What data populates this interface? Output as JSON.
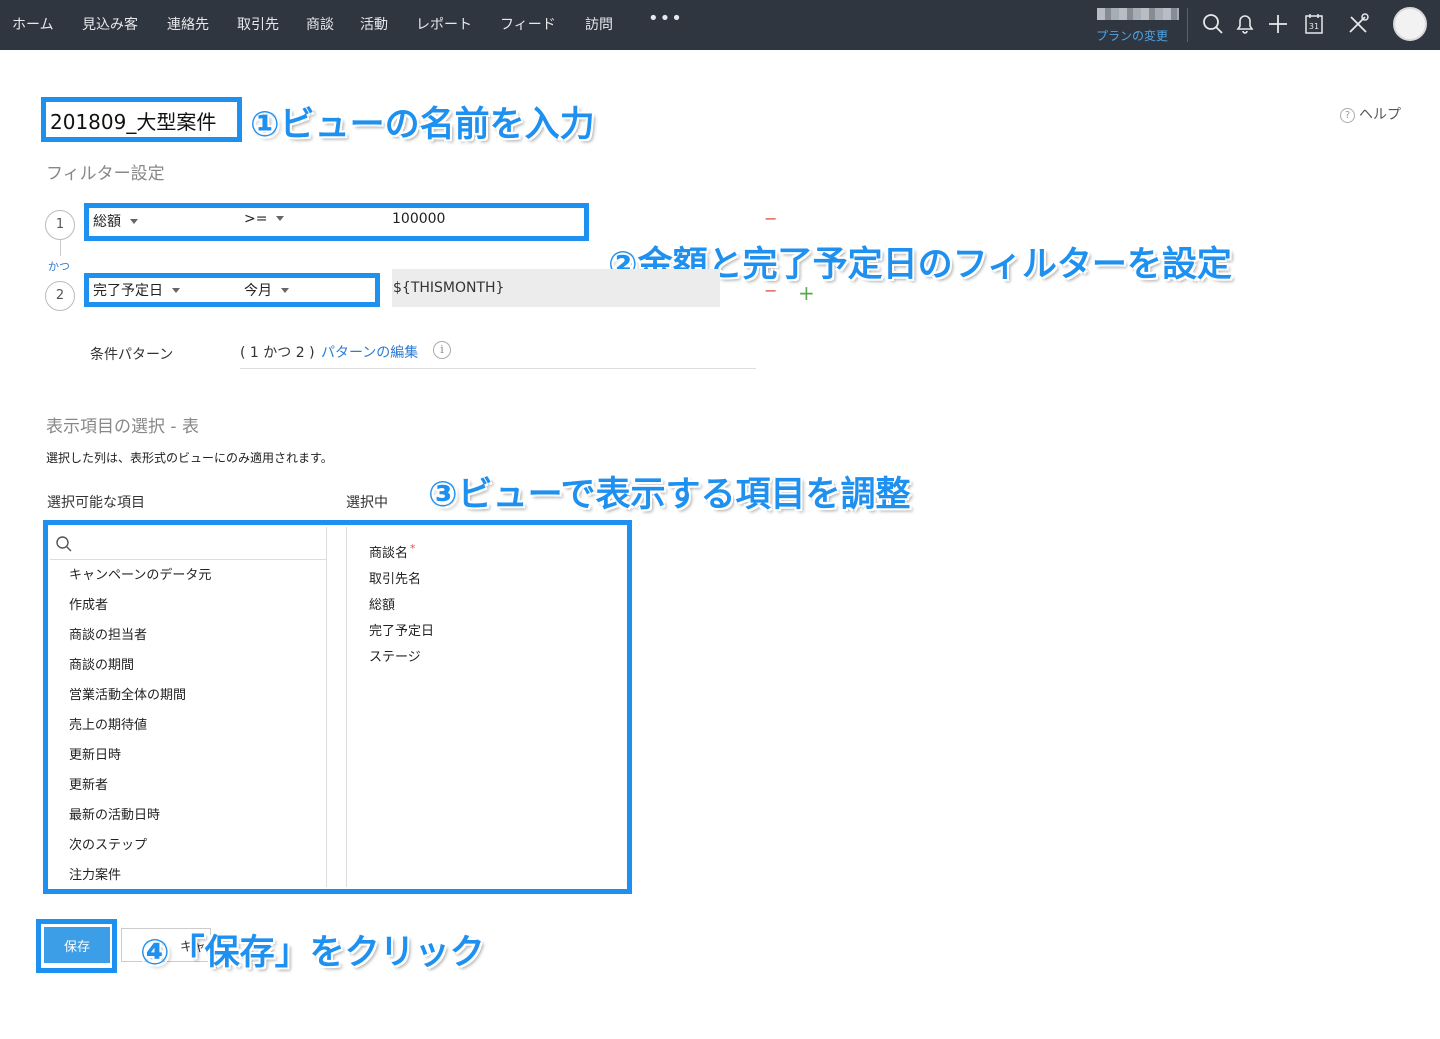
{
  "nav": {
    "items": [
      "ホーム",
      "見込み客",
      "連絡先",
      "取引先",
      "商談",
      "活動",
      "レポート",
      "フィード",
      "訪問"
    ],
    "more": "•••",
    "plan_change": "プランの変更",
    "icons": [
      "search-icon",
      "bell-icon",
      "plus-icon",
      "calendar-icon",
      "tools-icon",
      "avatar"
    ],
    "calendar_day": "31"
  },
  "help": {
    "label": "ヘルプ",
    "icon_glyph": "?"
  },
  "view_name": "201809_大型案件",
  "annotations": {
    "a1": "①ビューの名前を入力",
    "a2": "②金額と完了予定日のフィルターを設定",
    "a3": "③ビューで表示する項目を調整",
    "a4": "④「保存」をクリック"
  },
  "filter": {
    "title": "フィルター設定",
    "rows": [
      {
        "num": "1",
        "field": "総額",
        "operator": ">=",
        "value": "100000"
      },
      {
        "num": "2",
        "field": "完了予定日",
        "operator": "今月",
        "value": "${THISMONTH}"
      }
    ],
    "and_label": "かつ",
    "pattern_label": "条件パターン",
    "pattern_value": "( 1 かつ 2 )",
    "pattern_edit": "パターンの編集",
    "info_glyph": "i",
    "minus": "−",
    "plus": "+"
  },
  "columns": {
    "title": "表示項目の選択 - 表",
    "note": "選択した列は、表形式のビューにのみ適用されます。",
    "available_label": "選択可能な項目",
    "selected_label": "選択中",
    "available": [
      "キャンペーンのデータ元",
      "作成者",
      "商談の担当者",
      "商談の期間",
      "営業活動全体の期間",
      "売上の期待値",
      "更新日時",
      "更新者",
      "最新の活動日時",
      "次のステップ",
      "注力案件"
    ],
    "selected": [
      "商談名",
      "取引先名",
      "総額",
      "完了予定日",
      "ステージ"
    ],
    "required_mark": "*"
  },
  "buttons": {
    "save": "保存",
    "cancel": "キャンセル"
  },
  "colors": {
    "nav_bg": "#2f3640",
    "accent": "#1e90f0",
    "save_bg": "#3d9ee8",
    "link": "#2c7cd3",
    "remove": "#e0524a",
    "add": "#5aa84b"
  }
}
